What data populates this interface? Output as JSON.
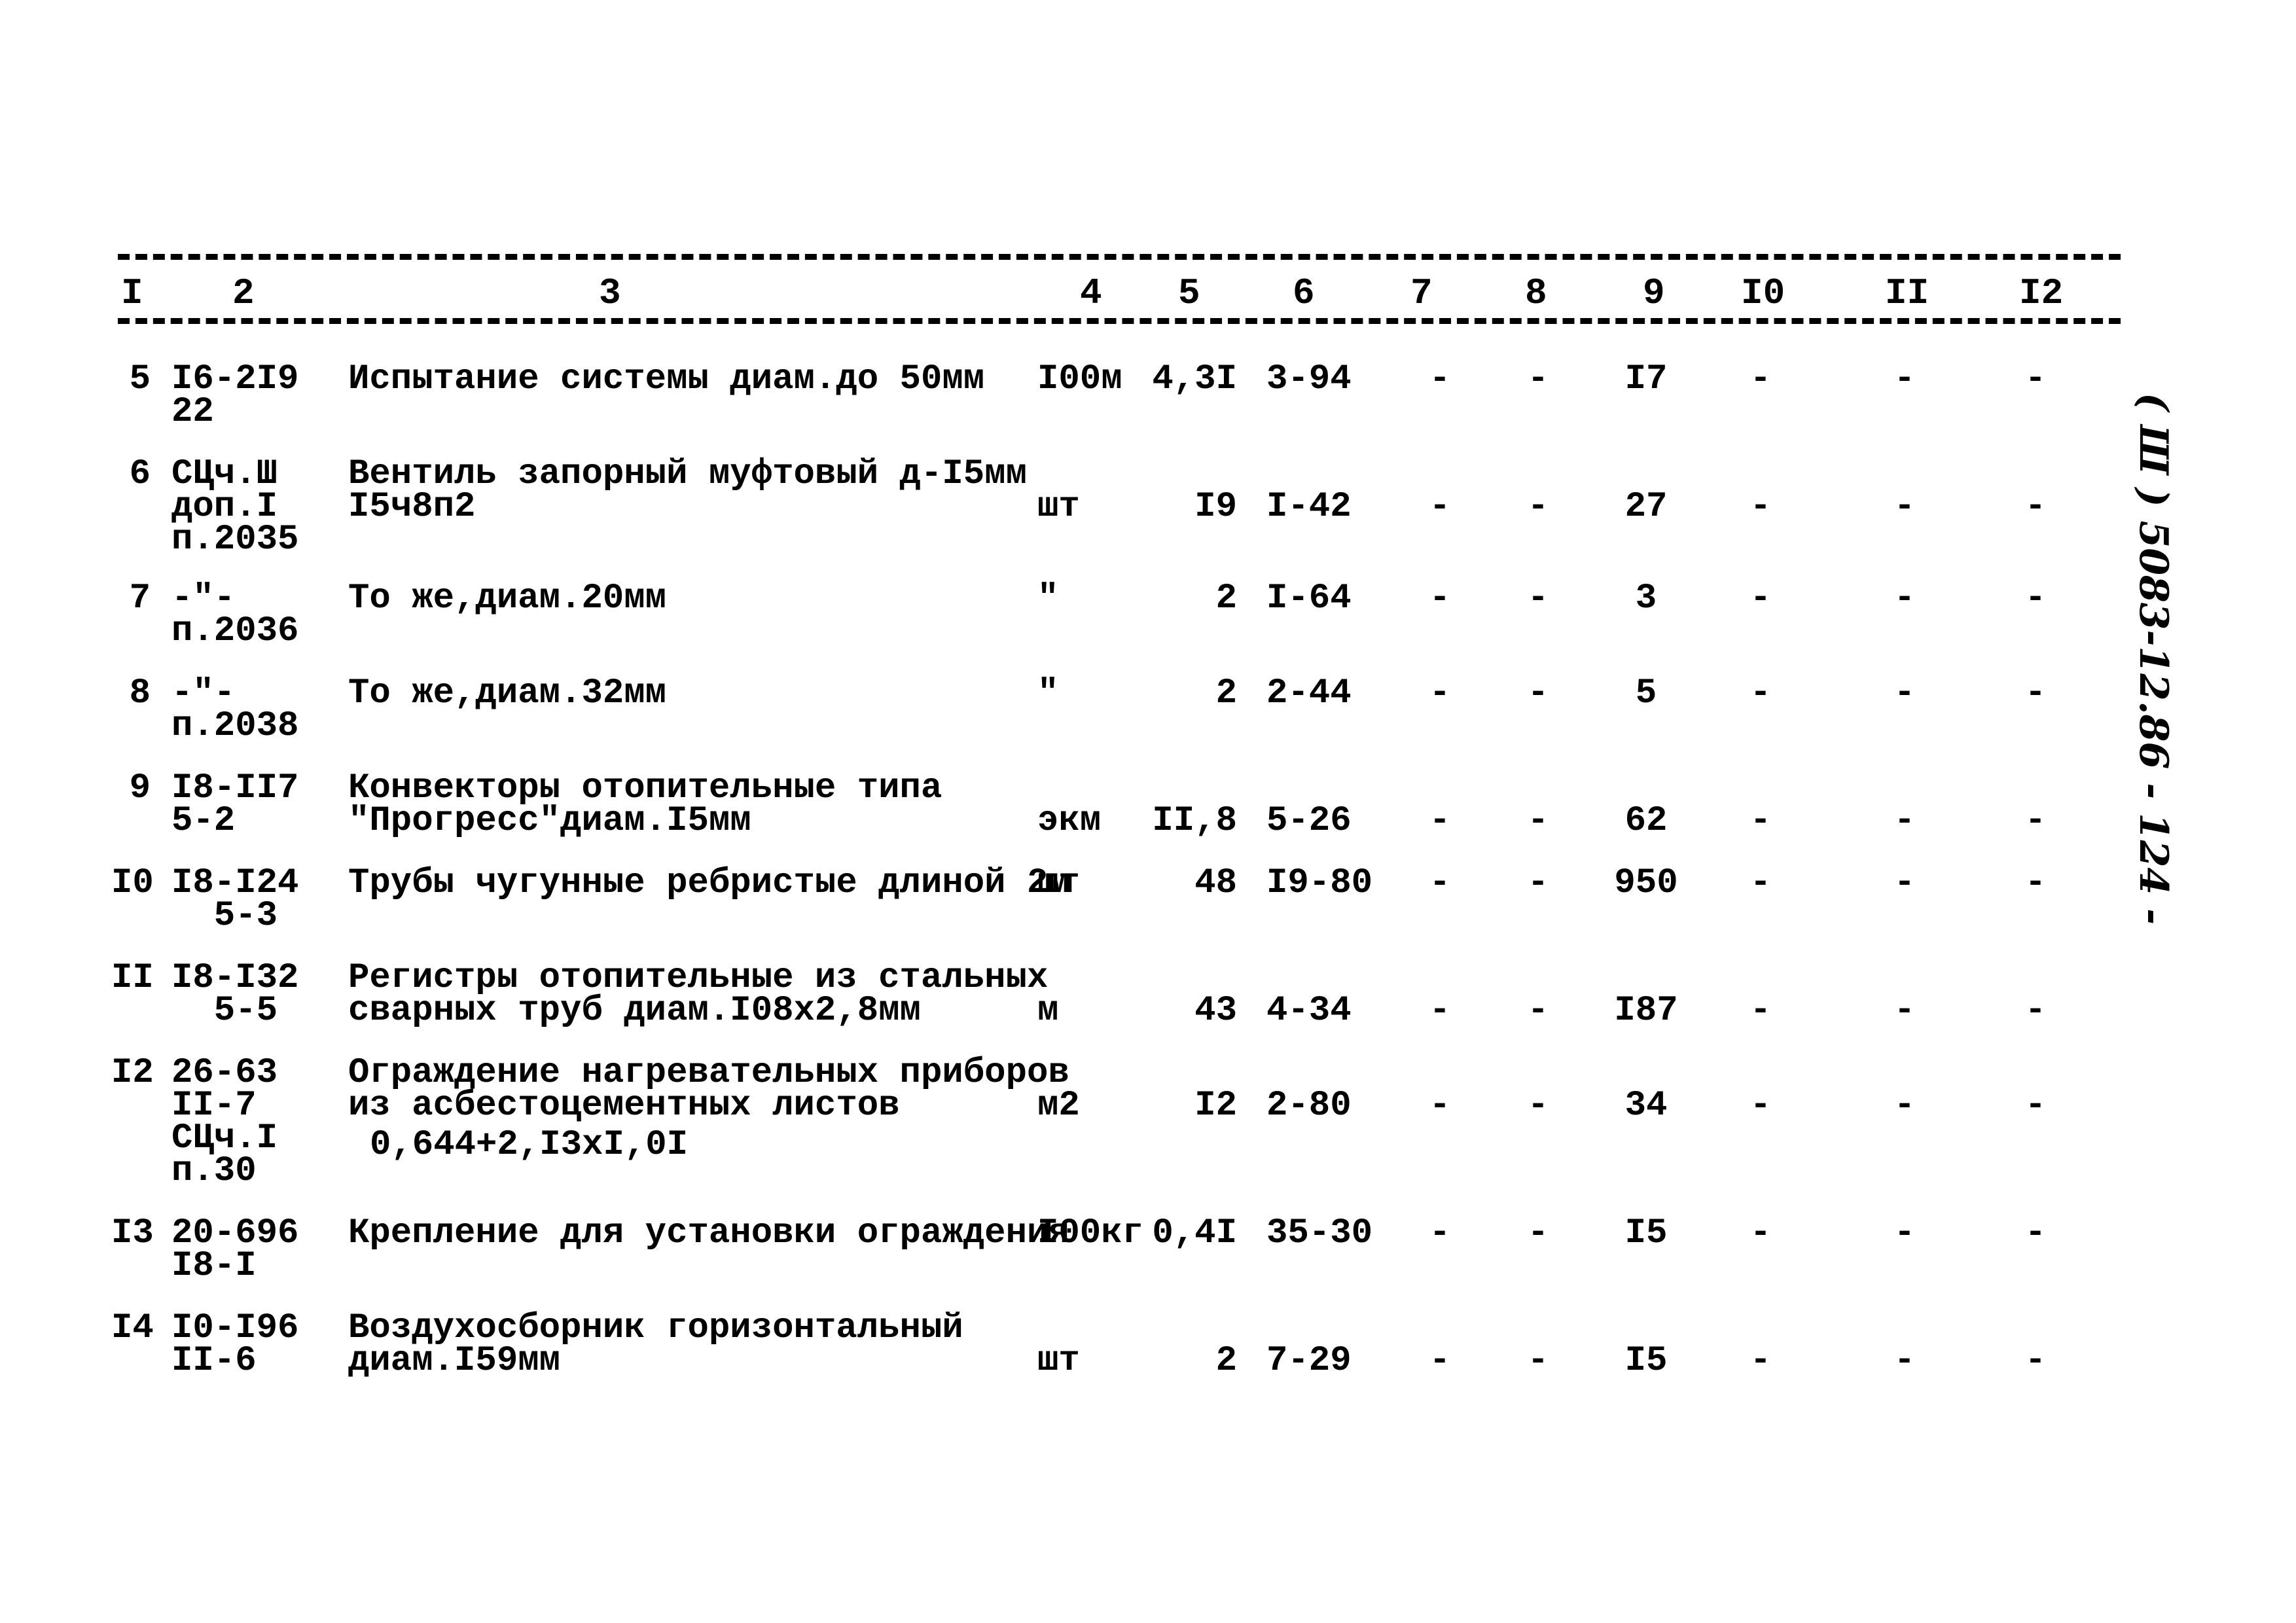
{
  "header": {
    "columns": [
      "I",
      "2",
      "3",
      "4",
      "5",
      "6",
      "7",
      "8",
      "9",
      "I0",
      "II",
      "I2"
    ]
  },
  "rows": [
    {
      "no": "5",
      "code": "I6-2I9\n22",
      "desc": "Испытание системы диам.до 50мм",
      "unit": "I00м",
      "qty": "4,3I",
      "price": "3-94",
      "c7": "-",
      "c8": "-",
      "c9": "I7",
      "c10": "-",
      "c11": "-",
      "c12": "-",
      "note": ""
    },
    {
      "no": "6",
      "code": "СЦч.Ш\nдоп.I\nп.2035",
      "desc": "Вентиль запорный муфтовый д-I5мм\nI5ч8п2",
      "unit": "шт",
      "qty": "I9",
      "price": "I-42",
      "c7": "-",
      "c8": "-",
      "c9": "27",
      "c10": "-",
      "c11": "-",
      "c12": "-",
      "note": ""
    },
    {
      "no": "7",
      "code": "-\"-\nп.2036",
      "desc": "То же,диам.20мм",
      "unit": "\"",
      "qty": "2",
      "price": "I-64",
      "c7": "-",
      "c8": "-",
      "c9": "3",
      "c10": "-",
      "c11": "-",
      "c12": "-",
      "note": ""
    },
    {
      "no": "8",
      "code": "-\"-\nп.2038",
      "desc": "То же,диам.32мм",
      "unit": "\"",
      "qty": "2",
      "price": "2-44",
      "c7": "-",
      "c8": "-",
      "c9": "5",
      "c10": "-",
      "c11": "-",
      "c12": "-",
      "note": ""
    },
    {
      "no": "9",
      "code": "I8-II7\n5-2",
      "desc": "Конвекторы отопительные типа\n\"Прогресс\"диам.I5мм",
      "unit": "экм",
      "qty": "II,8",
      "price": "5-26",
      "c7": "-",
      "c8": "-",
      "c9": "62",
      "c10": "-",
      "c11": "-",
      "c12": "-",
      "note": ""
    },
    {
      "no": "I0",
      "code": "I8-I24\n  5-3",
      "desc": "Трубы чугунные ребристые длиной 2м",
      "unit": "шт",
      "qty": "48",
      "price": "I9-80",
      "c7": "-",
      "c8": "-",
      "c9": "950",
      "c10": "-",
      "c11": "-",
      "c12": "-",
      "note": ""
    },
    {
      "no": "II",
      "code": "I8-I32\n  5-5",
      "desc": "Регистры отопительные из стальных\nсварных труб диам.I08х2,8мм",
      "unit": "м",
      "qty": "43",
      "price": "4-34",
      "c7": "-",
      "c8": "-",
      "c9": "I87",
      "c10": "-",
      "c11": "-",
      "c12": "-",
      "note": ""
    },
    {
      "no": "I2",
      "code": "26-63\nII-7\nСЦч.I\nп.30",
      "desc": "Ограждение нагревательных приборов\nиз асбестоцементных листов",
      "unit": "м2",
      "qty": "I2",
      "price": "2-80",
      "c7": "-",
      "c8": "-",
      "c9": "34",
      "c10": "-",
      "c11": "-",
      "c12": "-",
      "note": "0,644+2,I3хI,0I"
    },
    {
      "no": "I3",
      "code": "20-696\nI8-I",
      "desc": "Крепление для установки ограждения",
      "unit": "I00кг",
      "qty": "0,4I",
      "price": "35-30",
      "c7": "-",
      "c8": "-",
      "c9": "I5",
      "c10": "-",
      "c11": "-",
      "c12": "-",
      "note": ""
    },
    {
      "no": "I4",
      "code": "I0-I96\nII-6",
      "desc": "Воздухосборник горизонтальный\nдиам.I59мм",
      "unit": "шт",
      "qty": "2",
      "price": "7-29",
      "c7": "-",
      "c8": "-",
      "c9": "I5",
      "c10": "-",
      "c11": "-",
      "c12": "-",
      "note": ""
    }
  ],
  "margin_note": "( Ш ) 5083-12.86  -  124 -"
}
